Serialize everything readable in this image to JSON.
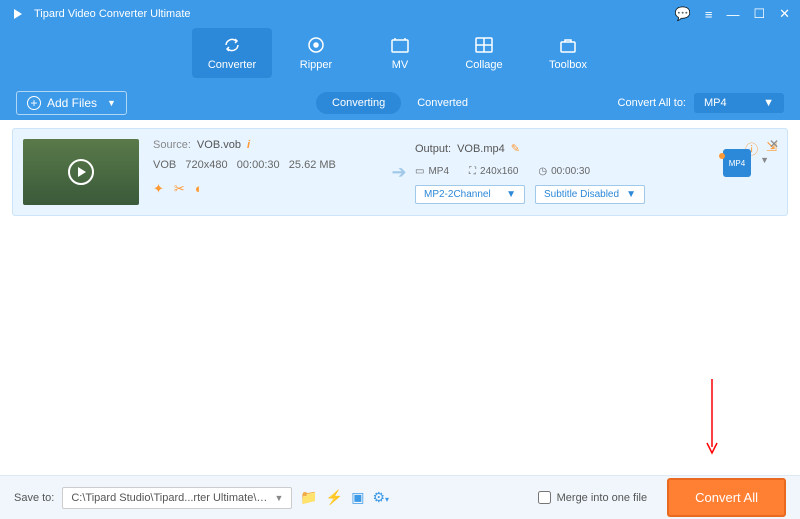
{
  "title": "Tipard Video Converter Ultimate",
  "nav": {
    "converter": "Converter",
    "ripper": "Ripper",
    "mv": "MV",
    "collage": "Collage",
    "toolbox": "Toolbox"
  },
  "subbar": {
    "addFiles": "Add Files",
    "tabConverting": "Converting",
    "tabConverted": "Converted",
    "convertAllTo": "Convert All to:",
    "format": "MP4"
  },
  "file": {
    "sourceLabel": "Source:",
    "sourceName": "VOB.vob",
    "container": "VOB",
    "resolution": "720x480",
    "duration": "00:00:30",
    "size": "25.62 MB",
    "outputLabel": "Output:",
    "outputName": "VOB.mp4",
    "outContainer": "MP4",
    "outResolution": "240x160",
    "outDuration": "00:00:30",
    "audio": "MP2-2Channel",
    "subtitle": "Subtitle Disabled",
    "badge": "MP4"
  },
  "bottom": {
    "saveTo": "Save to:",
    "path": "C:\\Tipard Studio\\Tipard...rter Ultimate\\Converted",
    "merge": "Merge into one file",
    "convertAll": "Convert All"
  }
}
